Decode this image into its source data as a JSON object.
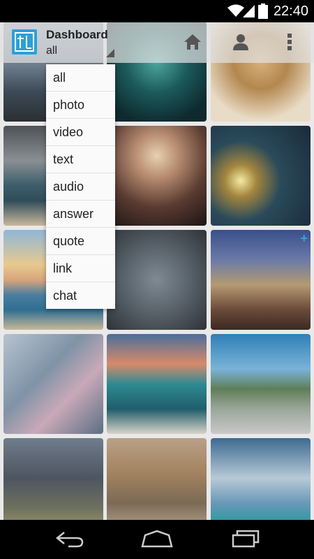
{
  "status": {
    "time": "22:40"
  },
  "header": {
    "title": "Dashboard",
    "subtitle": "all"
  },
  "filter_menu": {
    "items": [
      "all",
      "photo",
      "video",
      "text",
      "audio",
      "answer",
      "quote",
      "link",
      "chat"
    ]
  },
  "icons": {
    "logo": "tumblr-logo-icon",
    "home": "home-icon",
    "profile": "user-icon",
    "overflow": "overflow-menu-icon",
    "back": "back-icon",
    "nav_home": "home-nav-icon",
    "recents": "recent-apps-icon"
  },
  "colors": {
    "accent": "#2ba0d8",
    "background": "#e9e9e9"
  }
}
